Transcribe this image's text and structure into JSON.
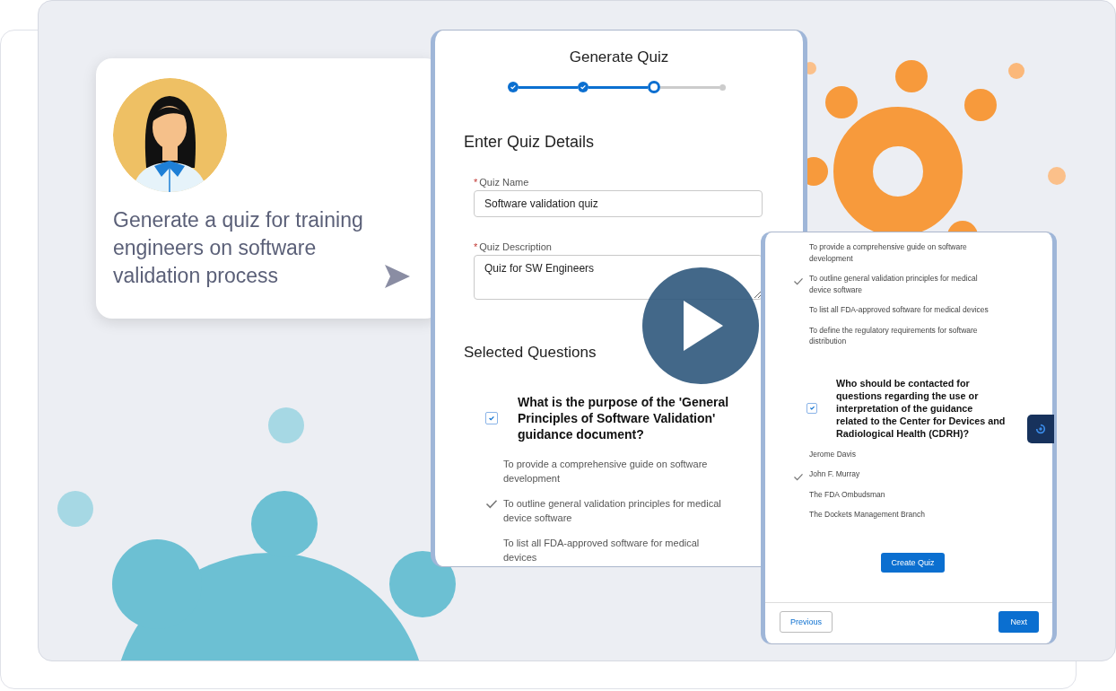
{
  "prompt_card": {
    "text": "Generate a quiz for training engineers on software validation process"
  },
  "quiz_panel": {
    "title": "Generate Quiz",
    "steps": [
      {
        "completed": true,
        "current": false
      },
      {
        "completed": true,
        "current": false
      },
      {
        "completed": false,
        "current": true
      },
      {
        "completed": false,
        "current": false
      }
    ],
    "section_title": "Enter Quiz Details",
    "fields": [
      {
        "kind": "input",
        "label": "Quiz Name",
        "required_mark": "*",
        "value": "Software validation quiz"
      },
      {
        "kind": "textarea",
        "label": "Quiz Description",
        "required_mark": "*",
        "value": "Quiz for SW Engineers"
      }
    ],
    "questions_title": "Selected Questions",
    "questions": [
      {
        "text": "What is the purpose of the 'General Principles of Software Validation' guidance document?",
        "checked": true,
        "answers": [
          {
            "text": "To provide a comprehensive guide on software development",
            "selected": false
          },
          {
            "text": "To outline general validation principles for medical device software",
            "selected": true
          },
          {
            "text": "To list all FDA-approved software for medical devices",
            "selected": false
          }
        ]
      }
    ]
  },
  "detail_panel": {
    "answers": [
      {
        "text": "To provide a comprehensive guide on software development",
        "selected": false
      },
      {
        "text": "To outline general validation principles for medical device software",
        "selected": true
      },
      {
        "text": "To list all FDA-approved software for medical devices",
        "selected": false
      },
      {
        "text": "To define the regulatory requirements for software distribution",
        "selected": false
      }
    ],
    "questions": [
      {
        "text": "Who should be contacted for questions regarding the use or interpretation of the guidance related to the Center for Devices and Radiological Health (CDRH)?",
        "checked": true,
        "answers": [
          {
            "text": "Jerome Davis",
            "selected": false
          },
          {
            "text": "John F. Murray",
            "selected": true
          },
          {
            "text": "The FDA Ombudsman",
            "selected": false
          },
          {
            "text": "The Dockets Management Branch",
            "selected": false
          }
        ]
      }
    ],
    "create_button": "Create Quiz",
    "previous_button": "Previous",
    "next_button": "Next"
  }
}
